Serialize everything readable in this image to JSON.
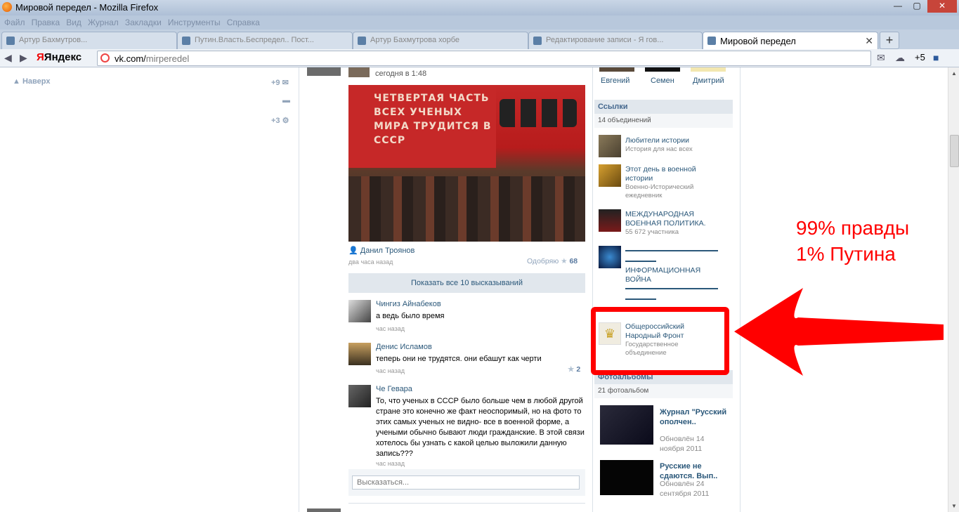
{
  "window": {
    "title": "Мировой передел - Mozilla Firefox"
  },
  "menu": [
    "Файл",
    "Правка",
    "Вид",
    "Журнал",
    "Закладки",
    "Инструменты",
    "Справка"
  ],
  "tabs": [
    {
      "label": "Артур Бахмутров..."
    },
    {
      "label": "Путин.Власть.Беспредел.. Пост..."
    },
    {
      "label": "Артур Бахмутрова хорбе"
    },
    {
      "label": "Редактирование записи - Я гов..."
    },
    {
      "label": "Мировой передел",
      "active": true
    }
  ],
  "nav": {
    "url_domain": "vk.com/",
    "url_path": "mirperedel",
    "yandex": "Яндекс",
    "count": "+5"
  },
  "left": {
    "naverh": "Наверх",
    "count1": "+9",
    "count2": "+3"
  },
  "post": {
    "time": "сегодня в 1:48",
    "photo_text": "ЧЕТВЕРТАЯ ЧАСТЬ ВСЕХ УЧЕНЫХ МИРА ТРУДИТСЯ В СССР",
    "author": "Данил Троянов",
    "when": "два часа назад",
    "like_label": "Одобряю",
    "likes": "68",
    "show_all": "Показать все 10 высказываний"
  },
  "comments": [
    {
      "name": "Чингиз Айнабеков",
      "text": "а ведь было время",
      "time": "час назад",
      "likes": ""
    },
    {
      "name": "Денис Исламов",
      "text": "теперь они не трудятся. они ебашут как черти",
      "time": "час назад",
      "likes": "2"
    },
    {
      "name": "Че Гевара",
      "text": "То, что ученых в СССР было больше чем в любой другой стране это конечно же факт неоспоримый, но на фото то этих самых ученых не видно- все в военной форме, а учеными обычно бывают люди гражданские. В этой связи хотелось бы узнать с какой целью выложили данную запись???",
      "time": "час назад",
      "likes": ""
    }
  ],
  "comment_input": {
    "placeholder": "Высказаться..."
  },
  "members": [
    "Евгений",
    "Семен",
    "Дмитрий"
  ],
  "links": {
    "title": "Ссылки",
    "count": "14 объединений",
    "items": [
      {
        "name": "Любители истории",
        "sub": "История для нас всех"
      },
      {
        "name": "Этот день в военной истории",
        "sub": "Военно-Исторический ежедневник"
      },
      {
        "name": "МЕЖДУНАРОДНАЯ ВОЕННАЯ ПОЛИТИКА.",
        "sub": "55 672 участника"
      },
      {
        "name": "ИНФОРМАЦИОННАЯ ВОЙНА",
        "sub": ""
      },
      {
        "name": "Общероссийский Народный Фронт",
        "sub": "Государственное объединение"
      }
    ]
  },
  "albums": {
    "title": "Фотоальбомы",
    "count": "21 фотоальбом",
    "items": [
      {
        "name": "Журнал \"Русский ополчен..",
        "sub": "Обновлён 14 ноября 2011"
      },
      {
        "name": "Русские не сдаются. Вып..",
        "sub": "Обновлён 24 сентября 2011"
      }
    ]
  },
  "annotation": {
    "line1": "99% правды",
    "line2": "1% Путина",
    "color": "#ff0000"
  }
}
